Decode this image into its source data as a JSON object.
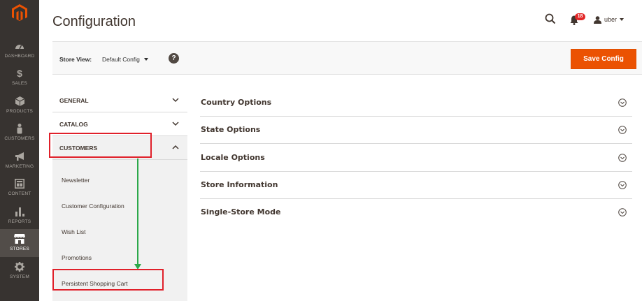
{
  "nav": {
    "items": [
      {
        "label": "DASHBOARD",
        "icon": "dashboard-icon"
      },
      {
        "label": "SALES",
        "icon": "dollar-icon"
      },
      {
        "label": "PRODUCTS",
        "icon": "cube-icon"
      },
      {
        "label": "CUSTOMERS",
        "icon": "person-icon"
      },
      {
        "label": "MARKETING",
        "icon": "megaphone-icon"
      },
      {
        "label": "CONTENT",
        "icon": "content-layout-icon"
      },
      {
        "label": "REPORTS",
        "icon": "bar-chart-icon"
      },
      {
        "label": "STORES",
        "icon": "storefront-icon",
        "active": true
      },
      {
        "label": "SYSTEM",
        "icon": "gear-icon"
      }
    ],
    "bg_color": "#373330",
    "active_color": "#524d49",
    "logo_color": "#eb5202"
  },
  "header": {
    "title": "Configuration",
    "notification_count": "18",
    "user_name": "uber"
  },
  "store_bar": {
    "label": "Store View:",
    "selected": "Default Config",
    "help": "?",
    "save_label": "Save Config",
    "save_color": "#eb5202"
  },
  "tabs": {
    "general": "GENERAL",
    "catalog": "CATALOG",
    "customers": "CUSTOMERS",
    "customers_items": [
      "Newsletter",
      "Customer Configuration",
      "Wish List",
      "Promotions",
      "Persistent Shopping Cart"
    ]
  },
  "sections": [
    "Country Options",
    "State Options",
    "Locale Options",
    "Store Information",
    "Single-Store Mode"
  ],
  "annotation": {
    "highlight_color": "#e0202a",
    "arrow_color": "#2ca84a"
  }
}
